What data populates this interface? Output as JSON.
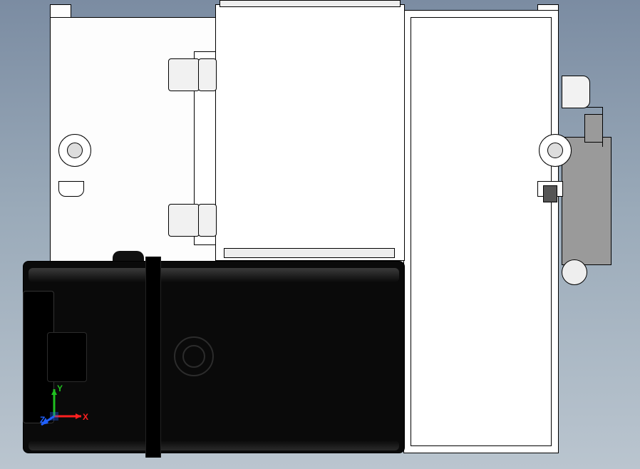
{
  "view": {
    "type": "CAD orthographic view",
    "orientation": "Front (+X right, +Y up)",
    "background": "gradient-blue-grey"
  },
  "triad": {
    "x": {
      "label": "X",
      "color": "#ff2020"
    },
    "y": {
      "label": "Y",
      "color": "#20c020"
    },
    "z": {
      "label": "Z",
      "color": "#2060ff"
    }
  },
  "assembly": {
    "main_housing": "white-machined-plate",
    "front_cover_plate": "raised-rectangular-cover",
    "mount_bosses": "2x standoff pairs, left side of cover",
    "fastener_left": "socket-head-cap-screw",
    "fastener_right": "socket-head-cap-screw",
    "right_bracket": "grey-sheet-metal-bracket",
    "top_connector": "cylindrical-port",
    "motor": "black-servo/stepper-motor, side-mounted",
    "motor_feature": "concentric circular boss on motor face"
  }
}
